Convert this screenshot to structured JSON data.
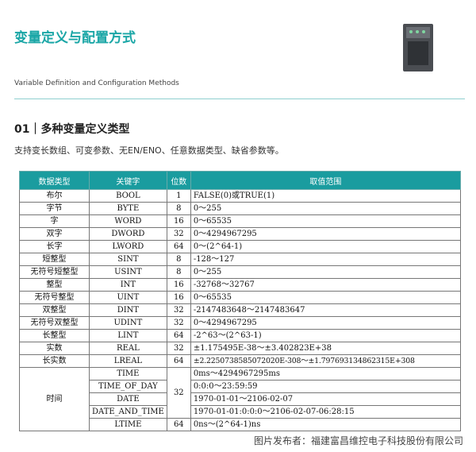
{
  "header": {
    "title": "变量定义与配置方式",
    "subtitle": "Variable Definition and Configuration Methods"
  },
  "section": {
    "title": "01｜多种变量定义类型",
    "description": "支持变长数组、可变参数、无EN/ENO、任意数据类型、缺省参数等。"
  },
  "table": {
    "headers": [
      "数据类型",
      "关键字",
      "位数",
      "取值范围"
    ],
    "rows": [
      {
        "type": "布尔",
        "keyword": "BOOL",
        "bits": "1",
        "range": "FALSE(0)或TRUE(1)"
      },
      {
        "type": "字节",
        "keyword": "BYTE",
        "bits": "8",
        "range": "0～255"
      },
      {
        "type": "字",
        "keyword": "WORD",
        "bits": "16",
        "range": "0～65535"
      },
      {
        "type": "双字",
        "keyword": "DWORD",
        "bits": "32",
        "range": "0～4294967295"
      },
      {
        "type": "长字",
        "keyword": "LWORD",
        "bits": "64",
        "range": "0～(2^64-1)"
      },
      {
        "type": "短整型",
        "keyword": "SINT",
        "bits": "8",
        "range": "-128～127"
      },
      {
        "type": "无符号短整型",
        "keyword": "USINT",
        "bits": "8",
        "range": "0～255"
      },
      {
        "type": "整型",
        "keyword": "INT",
        "bits": "16",
        "range": "-32768～32767"
      },
      {
        "type": "无符号整型",
        "keyword": "UINT",
        "bits": "16",
        "range": "0～65535"
      },
      {
        "type": "双整型",
        "keyword": "DINT",
        "bits": "32",
        "range": "-2147483648～2147483647"
      },
      {
        "type": "无符号双整型",
        "keyword": "UDINT",
        "bits": "32",
        "range": "0～4294967295"
      },
      {
        "type": "长整型",
        "keyword": "LINT",
        "bits": "64",
        "range": "-2^63～(2^63-1)"
      },
      {
        "type": "实数",
        "keyword": "REAL",
        "bits": "32",
        "range": "±1.175495E-38～±3.402823E+38"
      },
      {
        "type": "长实数",
        "keyword": "LREAL",
        "bits": "64",
        "range": "±2.2250738585072020E-308～±1.797693134862315E+308"
      }
    ],
    "time_group": {
      "type": "时间",
      "rows": [
        {
          "keyword": "TIME",
          "range": "0ms～4294967295ms"
        },
        {
          "keyword": "TIME_OF_DAY",
          "range": "0:0:0～23:59:59"
        },
        {
          "keyword": "DATE",
          "range": "1970-01-01～2106-02-07"
        },
        {
          "keyword": "DATE_AND_TIME",
          "range": "1970-01-01:0:0:0～2106-02-07-06:28:15"
        }
      ],
      "shared_bits": "32",
      "ltime": {
        "keyword": "LTIME",
        "bits": "64",
        "range": "0ns～(2^64-1)ns"
      }
    }
  },
  "footer": {
    "credit": "图片发布者：福建富昌维控电子科技股份有限公司"
  }
}
